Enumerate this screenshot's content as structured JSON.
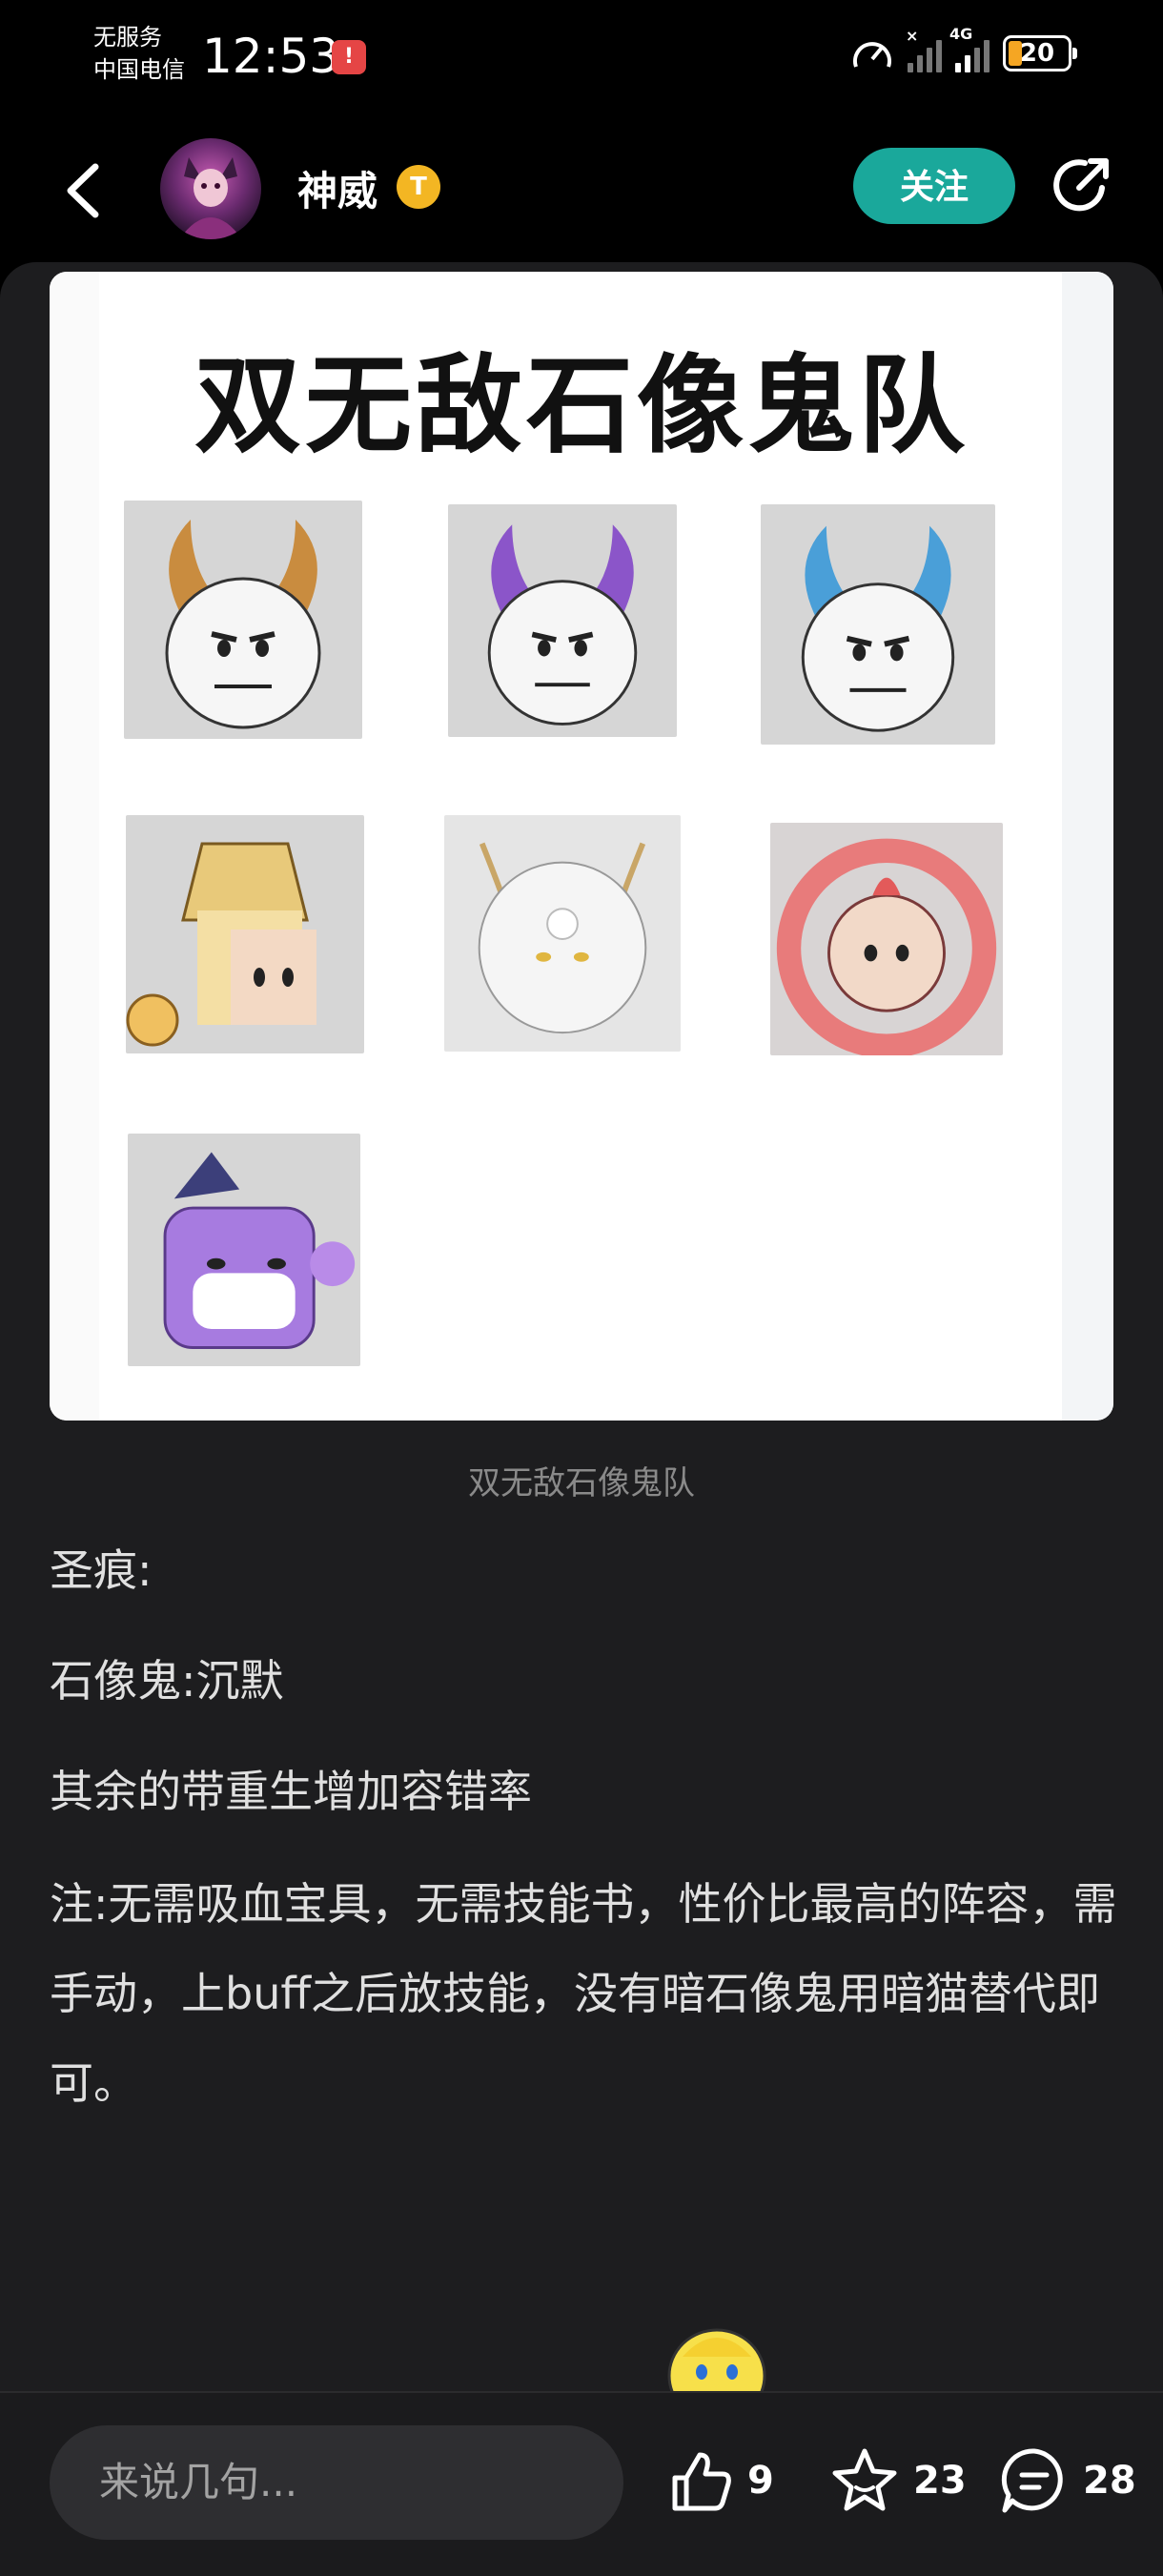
{
  "status_bar": {
    "carrier_line1": "无服务",
    "carrier_line2": "中国电信",
    "time": "12:53",
    "network": "4G",
    "battery": "20"
  },
  "header": {
    "username": "神威",
    "badge": "T",
    "follow_label": "关注"
  },
  "post": {
    "image_title": "双无敌石像鬼队",
    "caption": "双无敌石像鬼队",
    "paragraphs": [
      "圣痕:",
      "石像鬼:沉默",
      "其余的带重生增加容错率",
      "注:无需吸血宝具，无需技能书，性价比最高的阵容，需手动，上buff之后放技能，没有暗石像鬼用暗猫替代即可。"
    ]
  },
  "bottom_bar": {
    "comment_placeholder": "来说几句...",
    "likes": "9",
    "favorites": "23",
    "comments": "28"
  },
  "colors": {
    "accent": "#1aa89b",
    "background": "#1d1d1f",
    "badge": "#f3b623"
  }
}
